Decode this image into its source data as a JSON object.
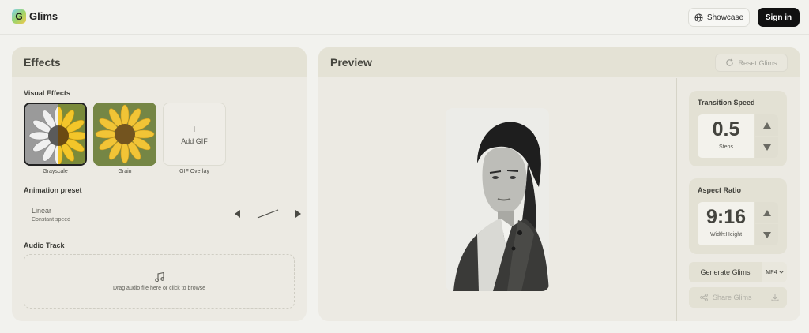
{
  "header": {
    "logo_letter": "G",
    "brand": "Glims",
    "showcase_label": "Showcase",
    "signin_label": "Sign in"
  },
  "effects": {
    "title": "Effects",
    "visual_effects_title": "Visual Effects",
    "thumbnails": [
      {
        "label": "Grayscale",
        "selected": true
      },
      {
        "label": "Grain",
        "selected": false
      }
    ],
    "add_gif_label": "Add GIF",
    "gif_overlay_label": "GIF Overlay",
    "animation_preset_title": "Animation preset",
    "preset_name": "Linear",
    "preset_desc": "Constant speed",
    "audio_track_title": "Audio Track",
    "dropzone_text": "Drag audio file here or click to browse"
  },
  "preview": {
    "title": "Preview",
    "reset_label": "Reset Glims",
    "transition": {
      "title": "Transition Speed",
      "value": "0.5",
      "unit": "Steps"
    },
    "aspect": {
      "title": "Aspect Ratio",
      "value": "9:16",
      "unit": "Width:Height"
    },
    "generate_label": "Generate Glims",
    "format_label": "MP4",
    "share_label": "Share Glims"
  },
  "colors": {
    "accent_dark": "#111111",
    "panel_bg": "#eceae3",
    "panel_header": "#e4e2d5"
  }
}
